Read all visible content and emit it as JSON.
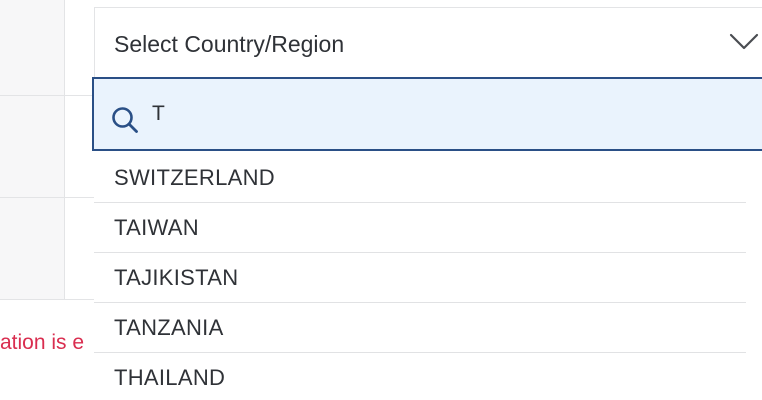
{
  "form": {
    "error_fragment": "ation is e"
  },
  "country_select": {
    "label": "Select Country/Region",
    "toggle_icon": "chevron-down-icon"
  },
  "search": {
    "icon": "search-icon",
    "value": "T"
  },
  "options": [
    {
      "label": "SWITZERLAND"
    },
    {
      "label": "TAIWAN"
    },
    {
      "label": "TAJIKISTAN"
    },
    {
      "label": "TANZANIA"
    },
    {
      "label": "THAILAND"
    }
  ],
  "colors": {
    "focus_border": "#2a4f86",
    "focus_bg": "#eaf3fd",
    "error_text": "#d92d4f",
    "text": "#2f3237",
    "divider": "#e1e2e4"
  }
}
